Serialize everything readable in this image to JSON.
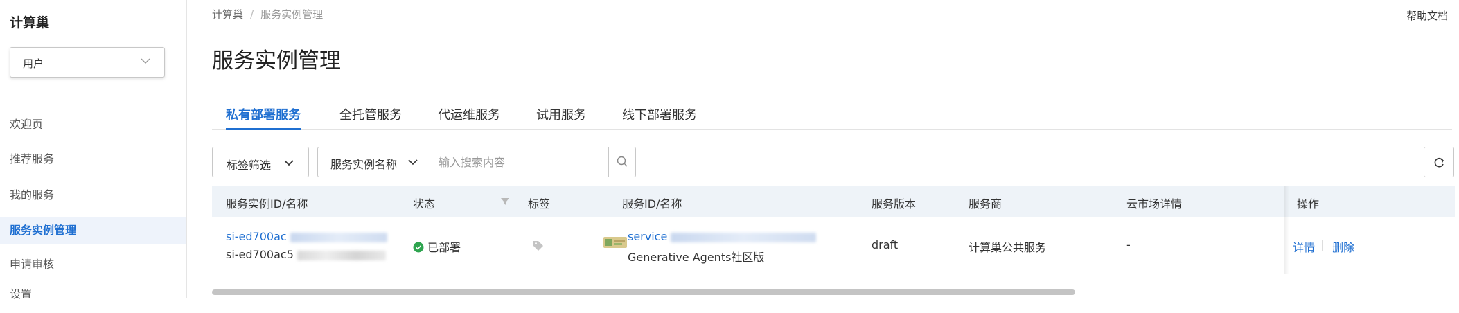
{
  "sidebar": {
    "title": "计算巢",
    "user_select": "用户",
    "items": [
      {
        "label": "欢迎页",
        "active": false
      },
      {
        "label": "推荐服务",
        "active": false
      },
      {
        "label": "我的服务",
        "active": false
      },
      {
        "label": "服务实例管理",
        "active": true
      },
      {
        "label": "申请审核",
        "active": false
      },
      {
        "label": "设置",
        "active": false
      }
    ]
  },
  "header": {
    "breadcrumb": [
      "计算巢",
      "服务实例管理"
    ],
    "help": "帮助文档",
    "title": "服务实例管理"
  },
  "tabs": [
    {
      "label": "私有部署服务",
      "active": true
    },
    {
      "label": "全托管服务",
      "active": false
    },
    {
      "label": "代运维服务",
      "active": false
    },
    {
      "label": "试用服务",
      "active": false
    },
    {
      "label": "线下部署服务",
      "active": false
    }
  ],
  "filters": {
    "tag_filter": "标签筛选",
    "field_select": "服务实例名称",
    "search_placeholder": "输入搜索内容"
  },
  "table": {
    "columns": [
      "服务实例ID/名称",
      "状态",
      "标签",
      "服务ID/名称",
      "服务版本",
      "服务商",
      "云市场详情",
      "操作"
    ],
    "rows": [
      {
        "instance_id": "si-ed700ac",
        "instance_name": "si-ed700ac5",
        "status": "已部署",
        "status_color": "#2ea44f",
        "service_id": "service",
        "service_name": "Generative Agents社区版",
        "version": "draft",
        "provider": "计算巢公共服务",
        "marketplace": "-",
        "actions": [
          "详情",
          "删除"
        ]
      }
    ]
  },
  "colors": {
    "accent": "#1f6fd1",
    "header_bg": "#eef3f8"
  }
}
